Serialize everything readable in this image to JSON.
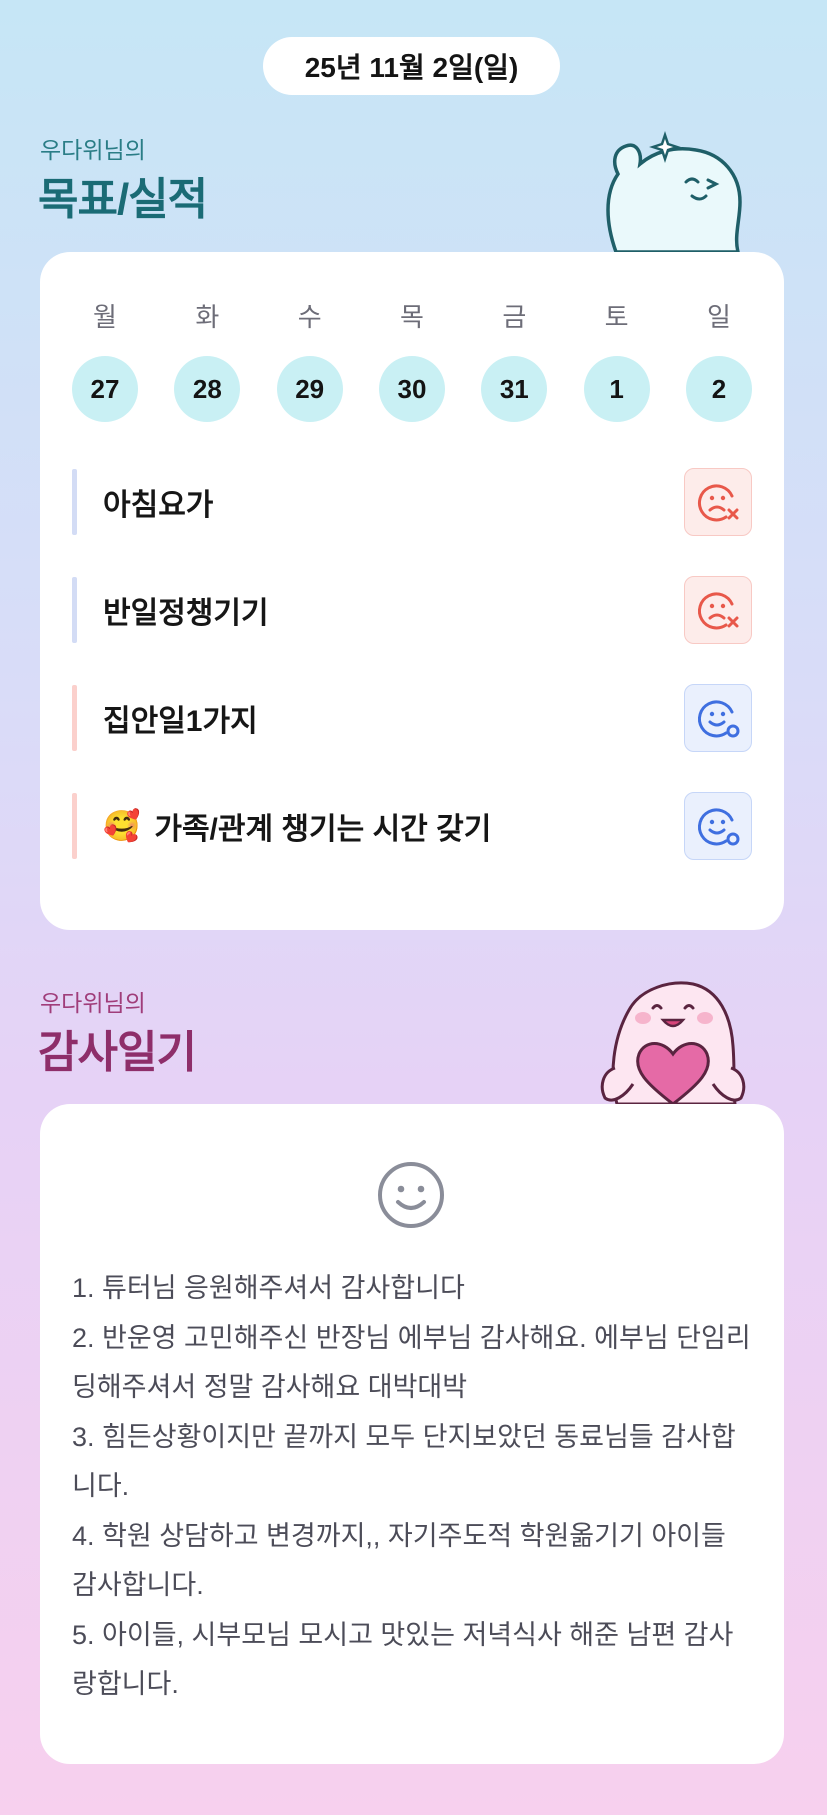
{
  "header": {
    "date": "25년 11월 2일(일)"
  },
  "goals_section": {
    "subtitle": "우다위님의",
    "title": "목표/실적"
  },
  "week": [
    {
      "label": "월",
      "date": "27"
    },
    {
      "label": "화",
      "date": "28"
    },
    {
      "label": "수",
      "date": "29"
    },
    {
      "label": "목",
      "date": "30"
    },
    {
      "label": "금",
      "date": "31"
    },
    {
      "label": "토",
      "date": "1"
    },
    {
      "label": "일",
      "date": "2"
    }
  ],
  "goals": [
    {
      "text": "아침요가",
      "emoji": "",
      "status": "fail",
      "icon": "sad-face-x-icon"
    },
    {
      "text": "반일정챙기기",
      "emoji": "",
      "status": "fail",
      "icon": "sad-face-x-icon"
    },
    {
      "text": "집안일1가지",
      "emoji": "",
      "status": "done",
      "icon": "smile-face-check-icon"
    },
    {
      "text": "가족/관계 챙기는 시간 갖기",
      "emoji": "🥰",
      "status": "done",
      "icon": "smile-face-check-icon"
    }
  ],
  "gratitude_section": {
    "subtitle": "우다위님의",
    "title": "감사일기",
    "icon": "smile-face-icon",
    "body": "1. 튜터님 응원해주셔서 감사합니다\n2. 반운영 고민해주신 반장님 에부님 감사해요. 에부님 단임리딩해주셔서 정말 감사해요 대박대박\n3. 힘든상황이지만 끝까지 모두 단지보았던 동료님들 감사합니다.\n4. 학원 상담하고 변경까지,, 자기주도적 학원옮기기 아이들 감사합니다.\n5. 아이들, 시부모님 모시고 맛있는 저녁식사 해준 남편 감사랑합니다."
  },
  "colors": {
    "goals_title": "#1a6b75",
    "gratitude_title": "#8e2e6a",
    "fail": "#e8584a",
    "done": "#3f6fe0",
    "day_circle": "#c9f0f4"
  }
}
